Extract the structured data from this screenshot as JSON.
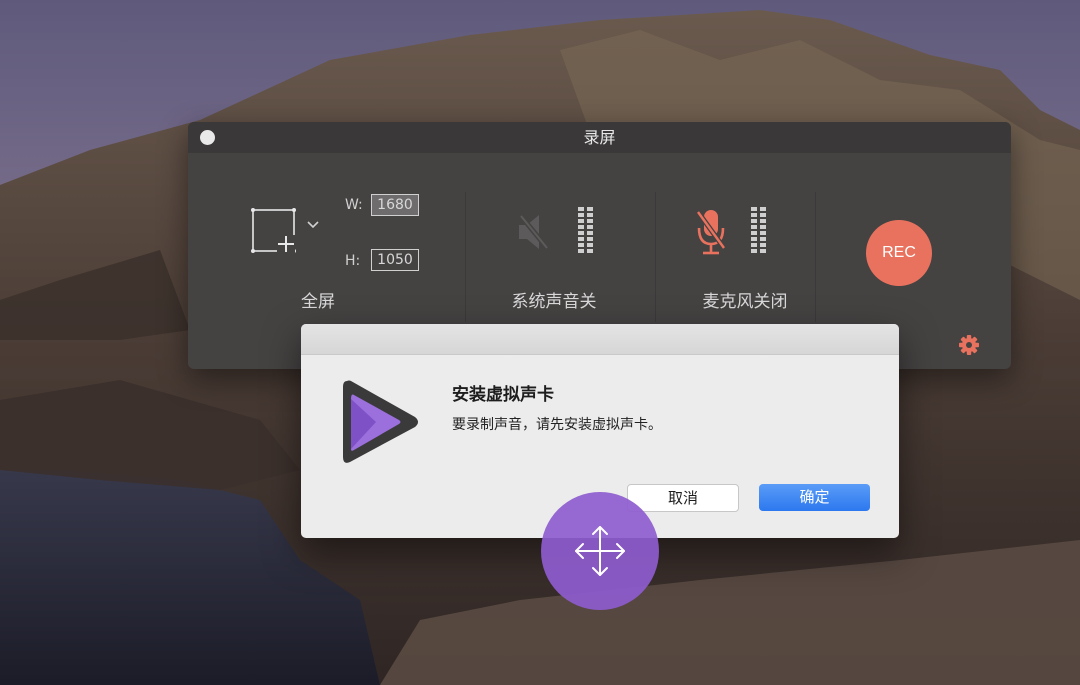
{
  "recorder": {
    "title": "录屏",
    "area": {
      "label": "全屏",
      "width_label": "W:",
      "height_label": "H:",
      "width_value": "1680",
      "height_value": "1050"
    },
    "system_audio": {
      "label": "系统声音关",
      "icon": "speaker-muted-icon"
    },
    "microphone": {
      "label": "麦克风关闭",
      "icon": "mic-muted-icon"
    },
    "rec_label": "REC",
    "colors": {
      "accent": "#e9725e",
      "window": "#454242"
    }
  },
  "dialog": {
    "title": "安装虚拟声卡",
    "message": "要录制声音，请先安装虚拟声卡。",
    "cancel_label": "取消",
    "ok_label": "确定",
    "icon": "app-play-icon"
  },
  "move_handle": {
    "icon": "move-arrows-icon",
    "color": "#8e5cce"
  }
}
